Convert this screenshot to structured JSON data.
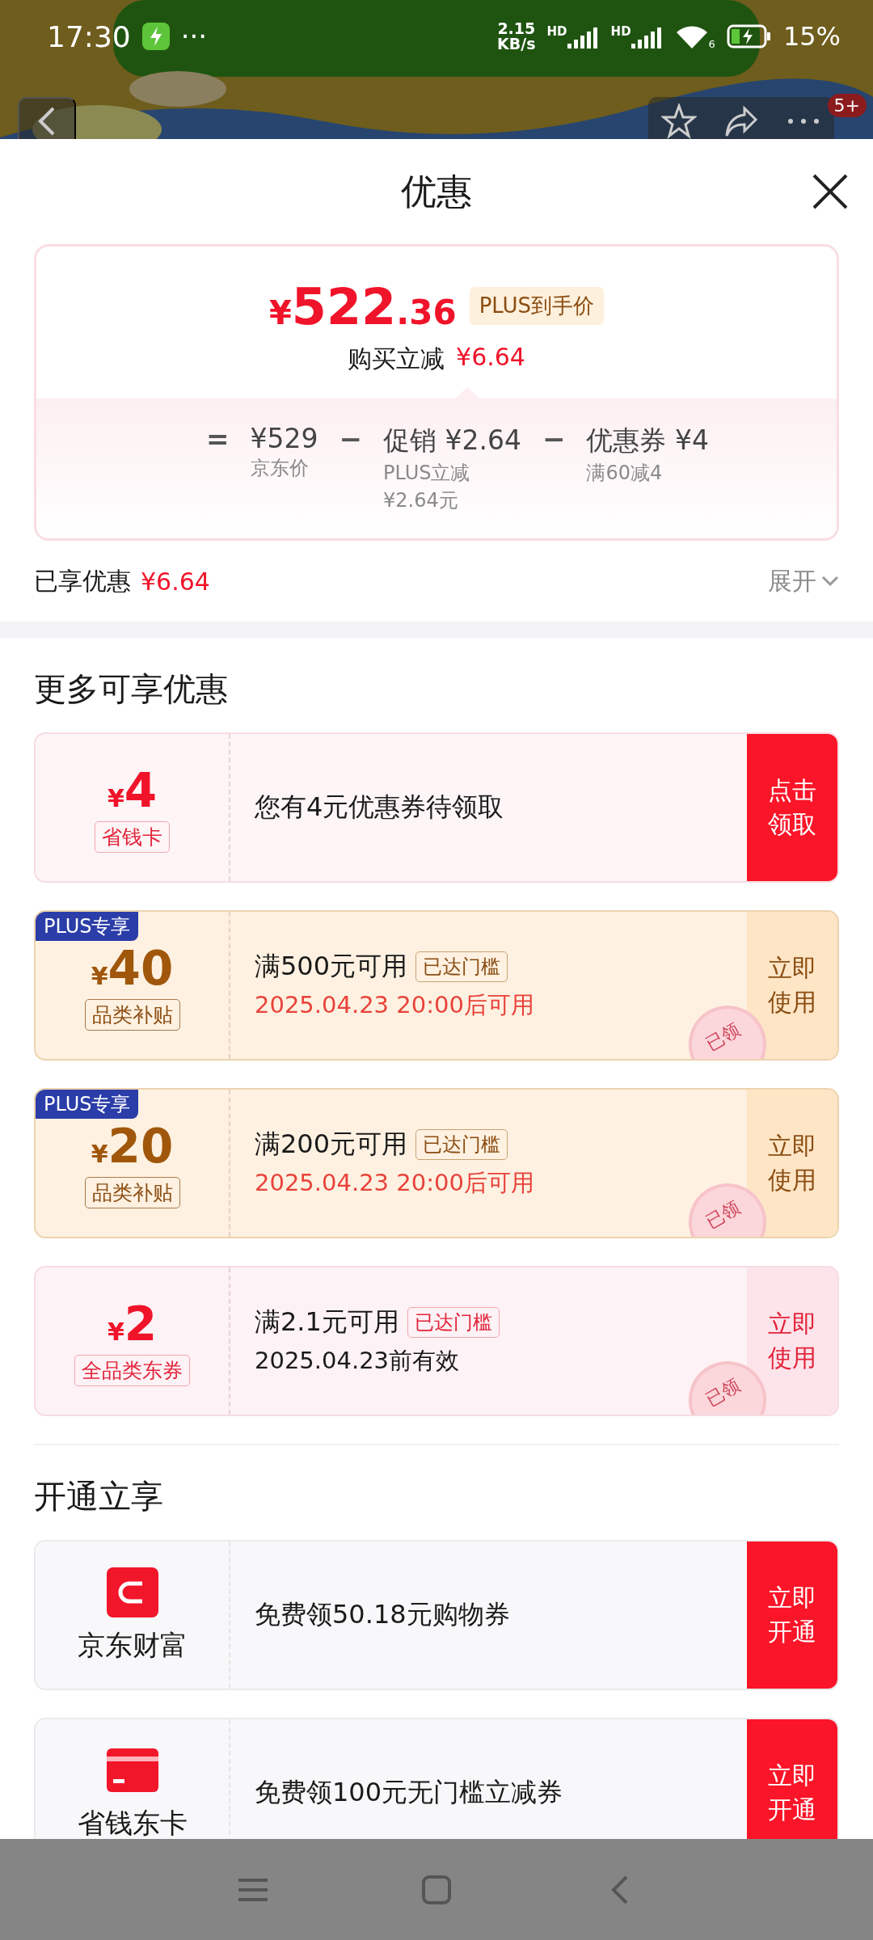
{
  "status_bar": {
    "time": "17:30",
    "more": "···",
    "speed_value": "2.15",
    "speed_unit": "KB/s",
    "sim_labels": [
      "HD",
      "HD"
    ],
    "wifi_label": "6",
    "battery": "15%"
  },
  "top_nav": {
    "badge": "5+"
  },
  "sheet": {
    "title": "优惠"
  },
  "price_card": {
    "currency": "¥",
    "price_int": "522",
    "price_dec": ".36",
    "tag": "PLUS到手价",
    "saving_label": "购买立减",
    "saving": "¥6.64",
    "breakdown": [
      {
        "operator": "=",
        "value": "¥529",
        "notes": [
          "京东价"
        ]
      },
      {
        "operator": "−",
        "value": "促销 ¥2.64",
        "notes": [
          "PLUS立减",
          "¥2.64元"
        ]
      },
      {
        "operator": "−",
        "value": "优惠券 ¥4",
        "notes": [
          "满60减4"
        ]
      }
    ]
  },
  "enjoyed": {
    "label": "已享优惠",
    "value": "¥6.64",
    "expand": "展开"
  },
  "coupons_title": "更多可享优惠",
  "coupons": [
    {
      "kind": "card",
      "currency": "¥",
      "amount": "4",
      "type_label": "省钱卡",
      "condition": "您有4元优惠券待领取",
      "action": [
        "点击",
        "领取"
      ]
    },
    {
      "kind": "plus",
      "plus_tag": "PLUS专享",
      "currency": "¥",
      "amount": "40",
      "type_label": "品类补贴",
      "condition": "满500元可用",
      "threshold_tag": "已达门槛",
      "validity": "2025.04.23 20:00后可用",
      "stamp": "已领",
      "action": [
        "立即",
        "使用"
      ]
    },
    {
      "kind": "plus",
      "plus_tag": "PLUS专享",
      "currency": "¥",
      "amount": "20",
      "type_label": "品类补贴",
      "condition": "满200元可用",
      "threshold_tag": "已达门槛",
      "validity": "2025.04.23 20:00后可用",
      "stamp": "已领",
      "action": [
        "立即",
        "使用"
      ]
    },
    {
      "kind": "jd",
      "currency": "¥",
      "amount": "2",
      "type_label": "全品类东券",
      "condition": "满2.1元可用",
      "threshold_tag": "已达门槛",
      "validity": "2025.04.23前有效",
      "stamp": "已领",
      "action": [
        "立即",
        "使用"
      ]
    }
  ],
  "services_title": "开通立享",
  "services": [
    {
      "kind": "wealth",
      "name": "京东财富",
      "description": "免费领50.18元购物券",
      "action": [
        "立即",
        "开通"
      ]
    },
    {
      "kind": "card",
      "name": "省钱东卡",
      "description": "免费领100元无门槛立减券",
      "action": [
        "立即",
        "开通"
      ]
    }
  ]
}
